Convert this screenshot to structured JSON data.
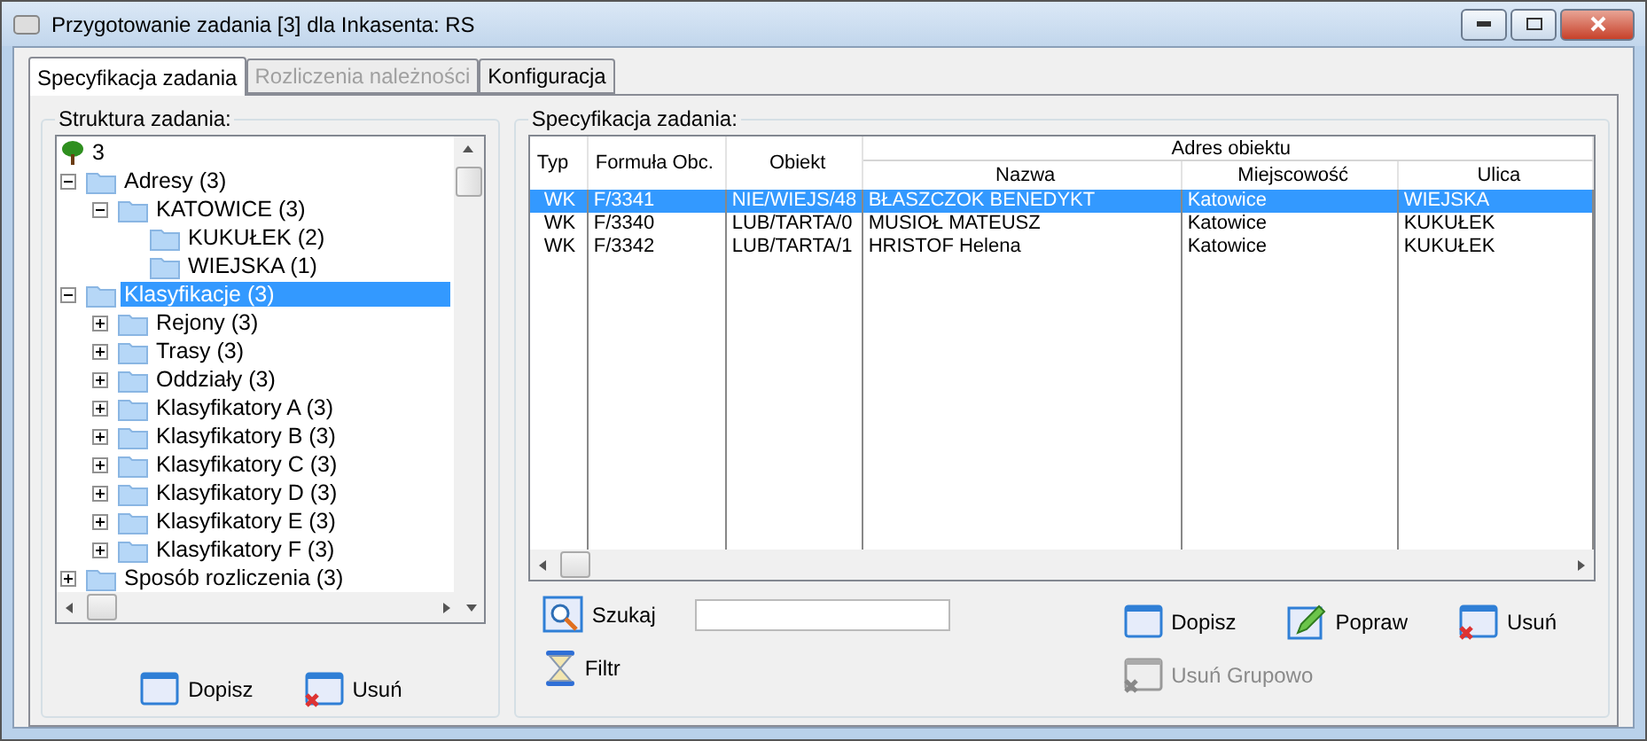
{
  "window": {
    "title": "Przygotowanie zadania [3] dla Inkasenta: RS"
  },
  "tabs": [
    {
      "label": "Specyfikacja zadania",
      "selected": true,
      "disabled": false
    },
    {
      "label": "Rozliczenia należności",
      "selected": false,
      "disabled": true
    },
    {
      "label": "Konfiguracja",
      "selected": false,
      "disabled": false
    }
  ],
  "tree_panel": {
    "title": "Struktura zadania:",
    "root": {
      "label": "3",
      "children": [
        {
          "label": "Adresy (3)",
          "expanded": true,
          "selected": false,
          "children": [
            {
              "label": "KATOWICE (3)",
              "expanded": true,
              "selected": false,
              "children": [
                {
                  "label": "KUKUŁEK (2)",
                  "selected": false
                },
                {
                  "label": "WIEJSKA (1)",
                  "selected": false
                }
              ]
            }
          ]
        },
        {
          "label": "Klasyfikacje (3)",
          "expanded": true,
          "selected": true,
          "children": [
            {
              "label": "Rejony (3)",
              "expanded": false,
              "selected": false
            },
            {
              "label": "Trasy (3)",
              "expanded": false,
              "selected": false
            },
            {
              "label": "Oddziały (3)",
              "expanded": false,
              "selected": false
            },
            {
              "label": "Klasyfikatory A (3)",
              "expanded": false,
              "selected": false
            },
            {
              "label": "Klasyfikatory B (3)",
              "expanded": false,
              "selected": false
            },
            {
              "label": "Klasyfikatory C (3)",
              "expanded": false,
              "selected": false
            },
            {
              "label": "Klasyfikatory D (3)",
              "expanded": false,
              "selected": false
            },
            {
              "label": "Klasyfikatory E (3)",
              "expanded": false,
              "selected": false
            },
            {
              "label": "Klasyfikatory F (3)",
              "expanded": false,
              "selected": false
            }
          ]
        },
        {
          "label": "Sposób rozliczenia (3)",
          "expanded": false,
          "selected": false
        }
      ]
    },
    "buttons": [
      {
        "label": "Dopisz",
        "kind": "add",
        "disabled": false
      },
      {
        "label": "Usuń",
        "kind": "delete",
        "disabled": false
      }
    ]
  },
  "spec_panel": {
    "title": "Specyfikacja zadania:",
    "table": {
      "group_header": "Adres obiektu",
      "columns": [
        "Typ",
        "Formuła Obc.",
        "Obiekt",
        "Nazwa",
        "Miejscowość",
        "Ulica"
      ],
      "rows": [
        {
          "selected": true,
          "cells": [
            "WK",
            "F/3341",
            "NIE/WIEJS/48",
            "BŁASZCZOK BENEDYKT",
            "Katowice",
            "WIEJSKA"
          ]
        },
        {
          "selected": false,
          "cells": [
            "WK",
            "F/3340",
            "LUB/TARTA/0",
            "MUSIOŁ MATEUSZ",
            "Katowice",
            "KUKUŁEK"
          ]
        },
        {
          "selected": false,
          "cells": [
            "WK",
            "F/3342",
            "LUB/TARTA/1",
            "HRISTOF Helena",
            "Katowice",
            "KUKUŁEK"
          ]
        }
      ]
    },
    "search": {
      "label": "Szukaj"
    },
    "filter": {
      "label": "Filtr"
    },
    "buttons": [
      {
        "label": "Dopisz",
        "kind": "add",
        "disabled": false
      },
      {
        "label": "Popraw",
        "kind": "edit",
        "disabled": false
      },
      {
        "label": "Usuń",
        "kind": "delete",
        "disabled": false
      }
    ],
    "group_delete": {
      "label": "Usuń Grupowo",
      "kind": "delete",
      "disabled": true
    }
  }
}
